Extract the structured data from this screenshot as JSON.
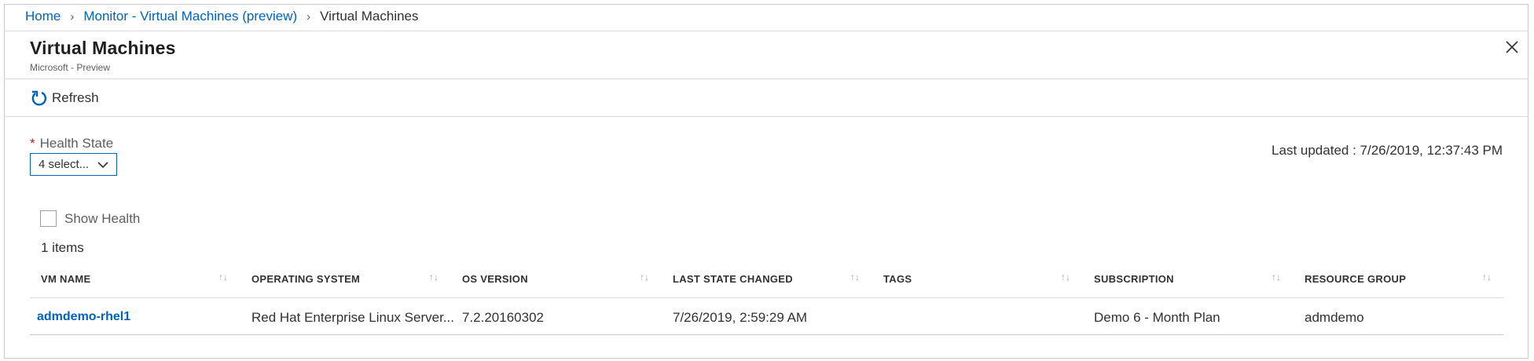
{
  "breadcrumb": {
    "items": [
      "Home",
      "Monitor - Virtual Machines (preview)"
    ],
    "current": "Virtual Machines"
  },
  "header": {
    "title": "Virtual Machines",
    "subtitle": "Microsoft - Preview"
  },
  "toolbar": {
    "refresh_label": "Refresh"
  },
  "filter": {
    "required_marker": "*",
    "label": "Health State",
    "selected_value": "4 select..."
  },
  "last_updated": "Last updated : 7/26/2019, 12:37:43 PM",
  "show_health_label": "Show Health",
  "items_count": "1 items",
  "table": {
    "columns": [
      "VM NAME",
      "OPERATING SYSTEM",
      "OS VERSION",
      "LAST STATE CHANGED",
      "TAGS",
      "SUBSCRIPTION",
      "RESOURCE GROUP"
    ],
    "sort_glyph": "↑↓",
    "rows": [
      {
        "vm_name": "admdemo-rhel1",
        "os": "Red Hat Enterprise Linux Server...",
        "os_version": "7.2.20160302",
        "last_state_changed": "7/26/2019, 2:59:29 AM",
        "tags": "",
        "subscription": "Demo 6 - Month Plan",
        "resource_group": "admdemo"
      }
    ]
  },
  "colors": {
    "link": "#0062c4",
    "required": "#a4262c",
    "text": "#323130"
  },
  "icons": {
    "refresh": "refresh-icon",
    "close": "close-icon",
    "dropdown": "chevron-down-icon",
    "sort": "sort-icon"
  }
}
